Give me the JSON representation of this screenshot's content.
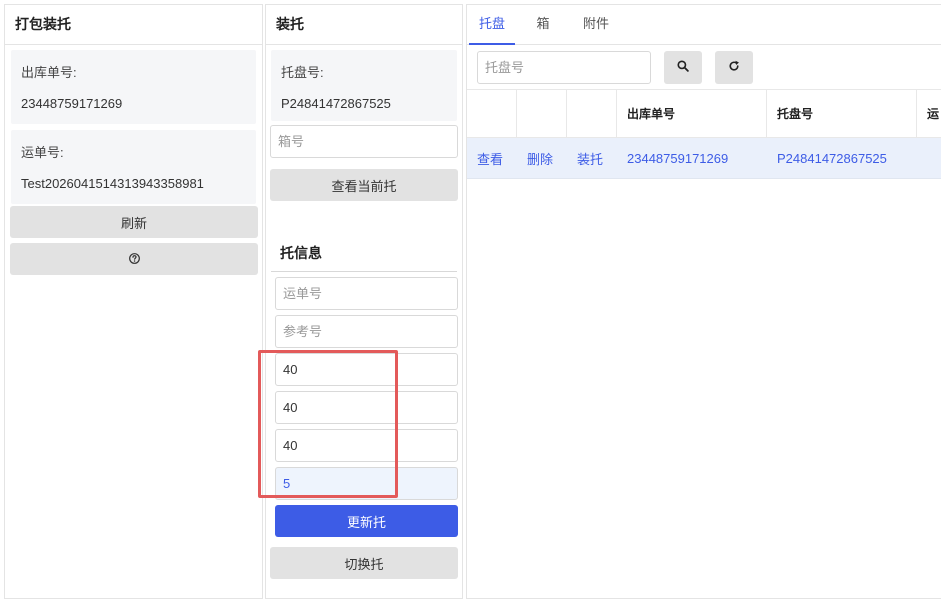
{
  "left_panel": {
    "title": "打包装托",
    "outbound_label": "出库单号:",
    "outbound_value": "23448759171269",
    "waybill_label": "运单号:",
    "waybill_value": "Test202604151431394335898​1",
    "refresh_label": "刷新",
    "help_icon": "question-circle-icon"
  },
  "mid_panel": {
    "title": "装托",
    "pallet_label": "托盘号:",
    "pallet_value": "P24841472867525",
    "box_placeholder": "箱号",
    "view_current_label": "查看当前托",
    "info_title": "托信息",
    "waybill_placeholder": "运单号",
    "reference_placeholder": "参考号",
    "dim1_value": "40",
    "dim2_value": "40",
    "dim3_value": "40",
    "dim4_value": "5",
    "update_label": "更新托",
    "switch_label": "切换托"
  },
  "right_panel": {
    "tabs": [
      "托盘",
      "箱",
      "附件"
    ],
    "active_tab": "托盘",
    "search_placeholder": "托盘号",
    "search_icon": "search-icon",
    "reset_icon": "refresh-icon",
    "columns": [
      "",
      "",
      "",
      "出库单号",
      "托盘号",
      "运"
    ],
    "rows": [
      {
        "view": "查看",
        "delete": "删除",
        "load": "装托",
        "outbound_no": "23448759171269",
        "pallet_no": "P24841472867525"
      }
    ]
  },
  "colors": {
    "accent": "#3d5ce6",
    "annotation": "#e35a5a",
    "panel_bg": "#f5f6f8",
    "button_gray": "#e2e2e2",
    "row_highlight": "#eaf0fb"
  }
}
